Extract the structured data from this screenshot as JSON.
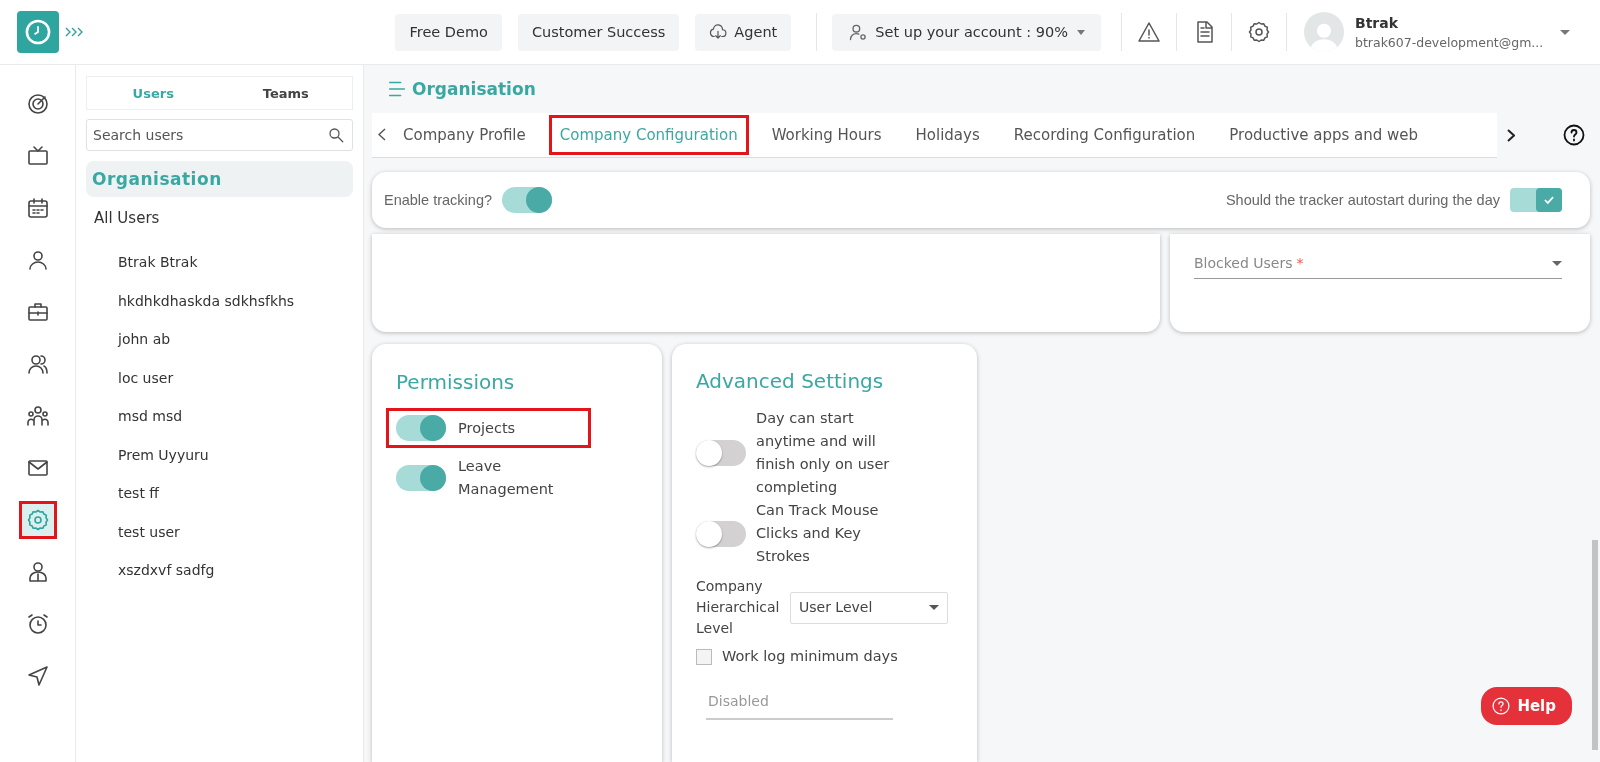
{
  "header": {
    "buttons": [
      {
        "label": "Free Demo",
        "kind": "plain"
      },
      {
        "label": "Customer Success",
        "kind": "plain"
      },
      {
        "label": "Agent",
        "kind": "cloud"
      }
    ],
    "setup": {
      "label": "Set up your account : 90%"
    },
    "tools": [
      {
        "kind": "warning"
      },
      {
        "kind": "document"
      },
      {
        "kind": "settings"
      }
    ],
    "user": {
      "name": "Btrak",
      "email": "btrak607-development@gm..."
    }
  },
  "rail": {
    "items": [
      {
        "kind": "target",
        "selected": false,
        "highlighted": false
      },
      {
        "kind": "tv",
        "selected": false,
        "highlighted": false
      },
      {
        "kind": "calendar",
        "selected": false,
        "highlighted": false
      },
      {
        "kind": "person",
        "selected": false,
        "highlighted": false
      },
      {
        "kind": "briefcase",
        "selected": false,
        "highlighted": false
      },
      {
        "kind": "people",
        "selected": false,
        "highlighted": false
      },
      {
        "kind": "team",
        "selected": false,
        "highlighted": false
      },
      {
        "kind": "mail",
        "selected": false,
        "highlighted": false
      },
      {
        "kind": "settings",
        "selected": true,
        "highlighted": true
      },
      {
        "kind": "badge",
        "selected": false,
        "highlighted": false
      },
      {
        "kind": "alarm",
        "selected": false,
        "highlighted": false
      },
      {
        "kind": "send",
        "selected": false,
        "highlighted": false
      }
    ]
  },
  "user_panel": {
    "tabs": [
      {
        "label": "Users",
        "selected": true
      },
      {
        "label": "Teams",
        "selected": false
      }
    ],
    "search": {
      "placeholder": "Search users"
    },
    "group": {
      "label": "Organisation",
      "selected": true
    },
    "all_users": "All Users",
    "users": [
      "Btrak Btrak",
      "hkdhkdhaskda sdkhsfkhs",
      "john ab",
      "loc user",
      "msd msd",
      "Prem Uyyuru",
      "test ff",
      "test user",
      "xszdxvf sadfg"
    ]
  },
  "main": {
    "title": "Organisation",
    "tabs": [
      {
        "label": "Company Profile",
        "selected": false,
        "highlighted": false
      },
      {
        "label": "Company Configuration",
        "selected": true,
        "highlighted": true
      },
      {
        "label": "Working Hours",
        "selected": false,
        "highlighted": false
      },
      {
        "label": "Holidays",
        "selected": false,
        "highlighted": false
      },
      {
        "label": "Recording Configuration",
        "selected": false,
        "highlighted": false
      },
      {
        "label": "Productive apps and web",
        "selected": false,
        "highlighted": false
      }
    ],
    "tracking": {
      "label": "Enable tracking?",
      "on": true
    },
    "autostart": {
      "label": "Should the tracker autostart during the day",
      "on": true
    },
    "blocked_users": {
      "label": "Blocked Users",
      "required_mark": "*"
    },
    "permissions": {
      "title": "Permissions",
      "items": [
        {
          "label": "Projects",
          "on": true,
          "highlighted": true
        },
        {
          "label": "Leave Management",
          "on": true,
          "highlighted": false
        }
      ]
    },
    "advanced": {
      "title": "Advanced Settings",
      "toggles": [
        {
          "label": "Day can start anytime and will finish only on user completing",
          "on": false
        },
        {
          "label": "Can Track Mouse Clicks and Key Strokes",
          "on": false
        }
      ],
      "hierarchy": {
        "label": "Company Hierarchical Level",
        "value": "User Level"
      },
      "work_log": {
        "label": "Work log minimum days",
        "checked": false
      },
      "days_field": {
        "placeholder": "Disabled"
      }
    },
    "help": {
      "label": "Help"
    }
  }
}
